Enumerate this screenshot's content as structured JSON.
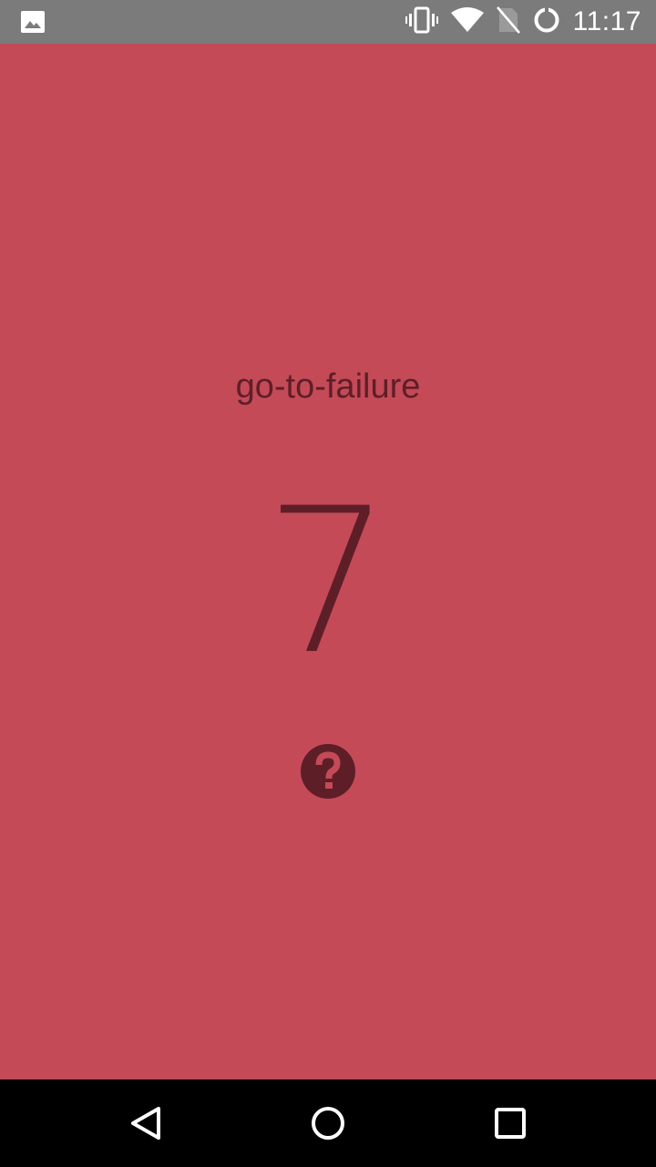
{
  "status_bar": {
    "time": "11:17",
    "icons": [
      "image-notification-icon",
      "vibrate-icon",
      "wifi-icon",
      "no-sim-icon",
      "sync-icon"
    ]
  },
  "main": {
    "mode_label": "go-to-failure",
    "count": "7",
    "help_icon": "help-circle-icon"
  },
  "nav_bar": {
    "buttons": [
      "back-icon",
      "home-icon",
      "recents-icon"
    ]
  },
  "colors": {
    "background": "#c44a58",
    "foreground": "#5e1e27",
    "status_bar": "#7b7b7b",
    "nav_bar": "#000000"
  }
}
